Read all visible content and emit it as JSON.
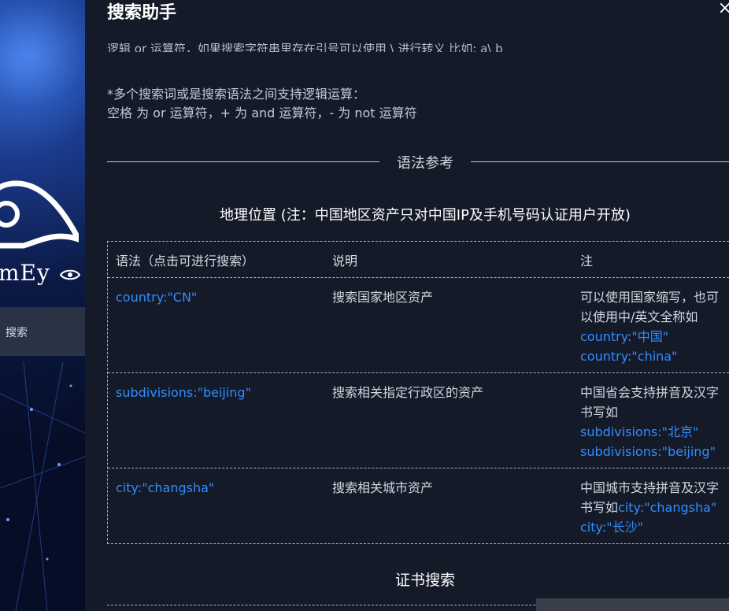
{
  "sidebar": {
    "brand": "mEy",
    "nav_item": "搜索"
  },
  "dialog": {
    "title": "搜索助手",
    "close": "×",
    "cut_text": "逻辑 or 运算符，如果搜索字符串里存在引号可以使用 \\ 进行转义 比如: a\\ b",
    "logic_line1": "*多个搜索词或是搜索语法之间支持逻辑运算：",
    "logic_line2": "空格 为 or 运算符，+ 为 and 运算符，- 为 not 运算符",
    "divider_label": "语法参考",
    "geo_title": "地理位置 (注：中国地区资产只对中国IP及手机号码认证用户开放)",
    "cert_title": "证书搜索"
  },
  "table": {
    "headers": [
      "语法（点击可进行搜索）",
      "说明",
      "注"
    ],
    "rows": [
      {
        "syntax": "country:\"CN\"",
        "desc": "搜索国家地区资产",
        "note_lines": [
          "可以使用国家缩写，也可",
          "以使用中/英文全称如"
        ],
        "note_links": [
          "country:\"中国\"",
          "country:\"china\""
        ]
      },
      {
        "syntax": "subdivisions:\"beijing\"",
        "desc": "搜索相关指定行政区的资产",
        "note_lines": [
          "中国省会支持拼音及汉字",
          "书写如"
        ],
        "note_links": [
          "subdivisions:\"北京\"",
          "subdivisions:\"beijing\""
        ]
      },
      {
        "syntax": "city:\"changsha\"",
        "desc": "搜索相关城市资产",
        "note_lines": [
          "中国城市支持拼音及汉字",
          "书写如"
        ],
        "note_links": [
          "city:\"changsha\"",
          "city:\"长沙\""
        ]
      }
    ]
  },
  "colors": {
    "background": "#151a29",
    "link": "#2f8dff",
    "text": "#d3d6de"
  }
}
